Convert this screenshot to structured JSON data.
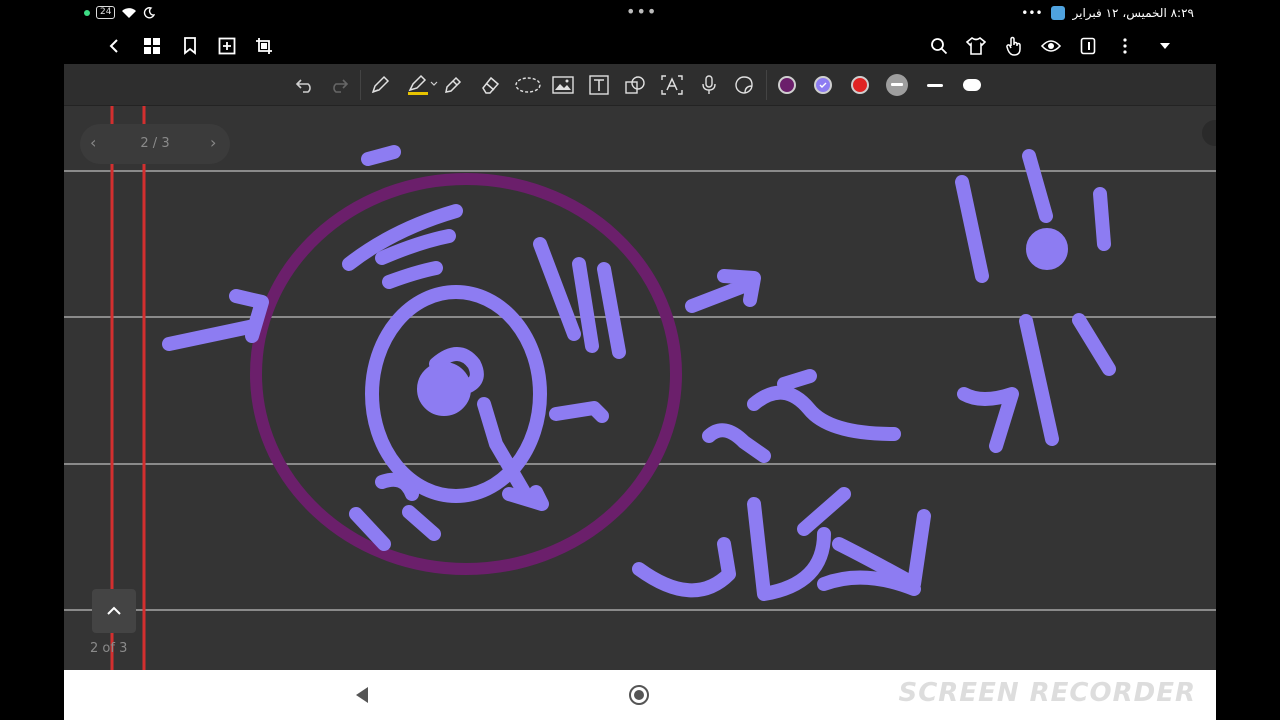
{
  "status_bar": {
    "battery": "24",
    "dots": "•••",
    "datetime": "٨:٢٩  الخميس، ١٢ فبراير",
    "more": "•••"
  },
  "top_nav": {
    "icons": [
      "back-icon",
      "grid-icon",
      "bookmark-icon",
      "add-page-icon",
      "crop-icon",
      "search-icon",
      "shirt-icon",
      "touch-icon",
      "eye-icon",
      "page-icon",
      "more-icon",
      "dropdown-icon"
    ]
  },
  "toolbar": {
    "tools": [
      "undo-icon",
      "redo-icon",
      "pen-icon",
      "highlighter-icon",
      "pencil-icon",
      "eraser-icon",
      "lasso-icon",
      "image-icon",
      "text-icon",
      "shape-icon",
      "text-recognition-icon",
      "microphone-icon",
      "sticker-icon"
    ],
    "colors": {
      "purple": "#6b1f6b",
      "lavender": "#8d7cf2",
      "red": "#e02424",
      "gray": "#9e9e9e"
    }
  },
  "page_nav": {
    "label": "2 / 3"
  },
  "page_counter": "2 of 3",
  "watermark": "SCREEN RECORDER",
  "colors": {
    "canvas": "#343434",
    "ink_lavender": "#8d7cf2",
    "ink_purple": "#6b1f6b",
    "rule_line": "#8a8a8a",
    "margin_red": "#d32f2f"
  }
}
